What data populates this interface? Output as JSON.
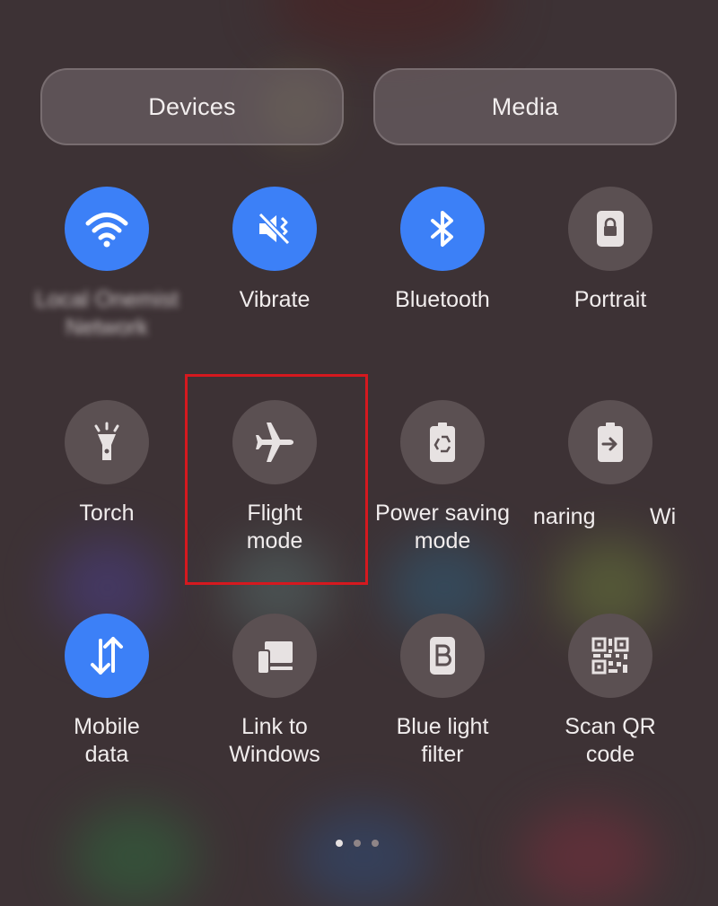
{
  "tabs": {
    "devices": "Devices",
    "media": "Media"
  },
  "tiles": {
    "wifi": {
      "label": "Local Onemist\nNetwork",
      "icon": "wifi-icon",
      "on": true
    },
    "vibrate": {
      "label": "Vibrate",
      "icon": "vibrate-icon",
      "on": true
    },
    "bluetooth": {
      "label": "Bluetooth",
      "icon": "bluetooth-icon",
      "on": true
    },
    "portrait": {
      "label": "Portrait",
      "icon": "portrait-lock-icon",
      "on": false
    },
    "torch": {
      "label": "Torch",
      "icon": "torch-icon",
      "on": false
    },
    "flight": {
      "label": "Flight\nmode",
      "icon": "airplane-icon",
      "on": false
    },
    "power_saving": {
      "label": "Power saving\nmode",
      "icon": "battery-recycle-icon",
      "on": false
    },
    "sharing": {
      "label": "naring",
      "icon": "battery-share-icon",
      "on": false
    },
    "partial": {
      "label": "Wi"
    },
    "mobile_data": {
      "label": "Mobile\ndata",
      "icon": "mobile-data-icon",
      "on": true
    },
    "link_windows": {
      "label": "Link to\nWindows",
      "icon": "link-windows-icon",
      "on": false
    },
    "blue_light": {
      "label": "Blue light\nfilter",
      "icon": "blue-light-icon",
      "on": false
    },
    "scan_qr": {
      "label": "Scan QR\ncode",
      "icon": "qr-code-icon",
      "on": false
    }
  },
  "colors": {
    "active": "#3c80f7",
    "inactive": "#5b5052",
    "highlight": "#d5191f"
  },
  "pager": {
    "pages": 3,
    "current": 1
  }
}
